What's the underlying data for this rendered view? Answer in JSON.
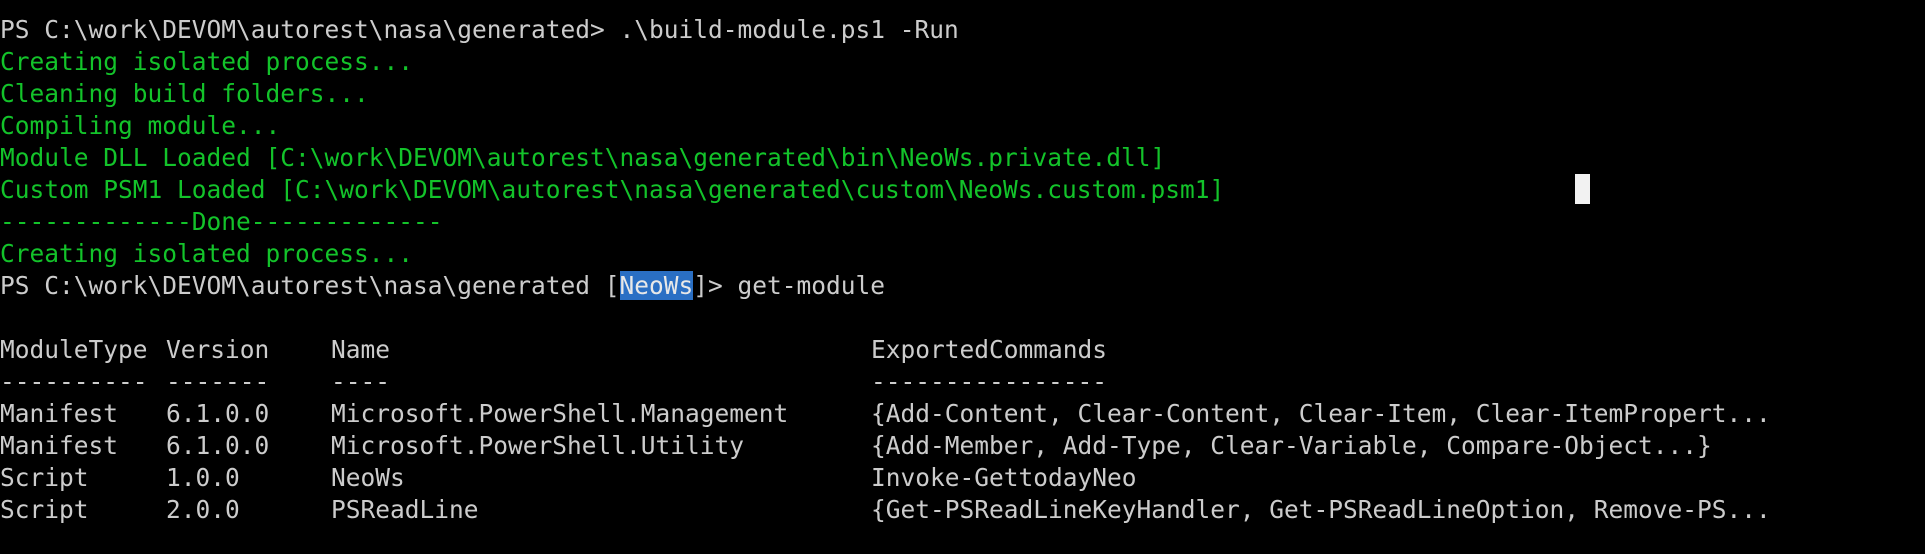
{
  "terminal": {
    "prompt1": "PS C:\\work\\DEVOM\\autorest\\nasa\\generated> ",
    "command1": ".\\build-module.ps1 -Run",
    "output": [
      "Creating isolated process...",
      "Cleaning build folders...",
      "Compiling module...",
      "Module DLL Loaded [C:\\work\\DEVOM\\autorest\\nasa\\generated\\bin\\NeoWs.private.dll]",
      "Custom PSM1 Loaded [C:\\work\\DEVOM\\autorest\\nasa\\generated\\custom\\NeoWs.custom.psm1]",
      "-------------Done-------------",
      "Creating isolated process..."
    ],
    "prompt2_prefix": "PS C:\\work\\DEVOM\\autorest\\nasa\\generated [",
    "prompt2_selected": "NeoWs",
    "prompt2_suffix": "]> ",
    "command2": "get-module"
  },
  "table": {
    "headers": [
      "ModuleType",
      "Version",
      "Name",
      "ExportedCommands"
    ],
    "separators": [
      "----------",
      "-------",
      "----",
      "----------------"
    ],
    "rows": [
      [
        "Manifest",
        "6.1.0.0",
        "Microsoft.PowerShell.Management",
        "{Add-Content, Clear-Content, Clear-Item, Clear-ItemPropert..."
      ],
      [
        "Manifest",
        "6.1.0.0",
        "Microsoft.PowerShell.Utility",
        "{Add-Member, Add-Type, Clear-Variable, Compare-Object...}"
      ],
      [
        "Script",
        "1.0.0",
        "NeoWs",
        "Invoke-GettodayNeo"
      ],
      [
        "Script",
        "2.0.0",
        "PSReadLine",
        "{Get-PSReadLineKeyHandler, Get-PSReadLineOption, Remove-PS..."
      ]
    ]
  },
  "colors": {
    "background": "#000000",
    "text": "#cccccc",
    "green": "#13c32a",
    "selection": "#2a6fc4",
    "cursor": "#f2f2f2"
  }
}
